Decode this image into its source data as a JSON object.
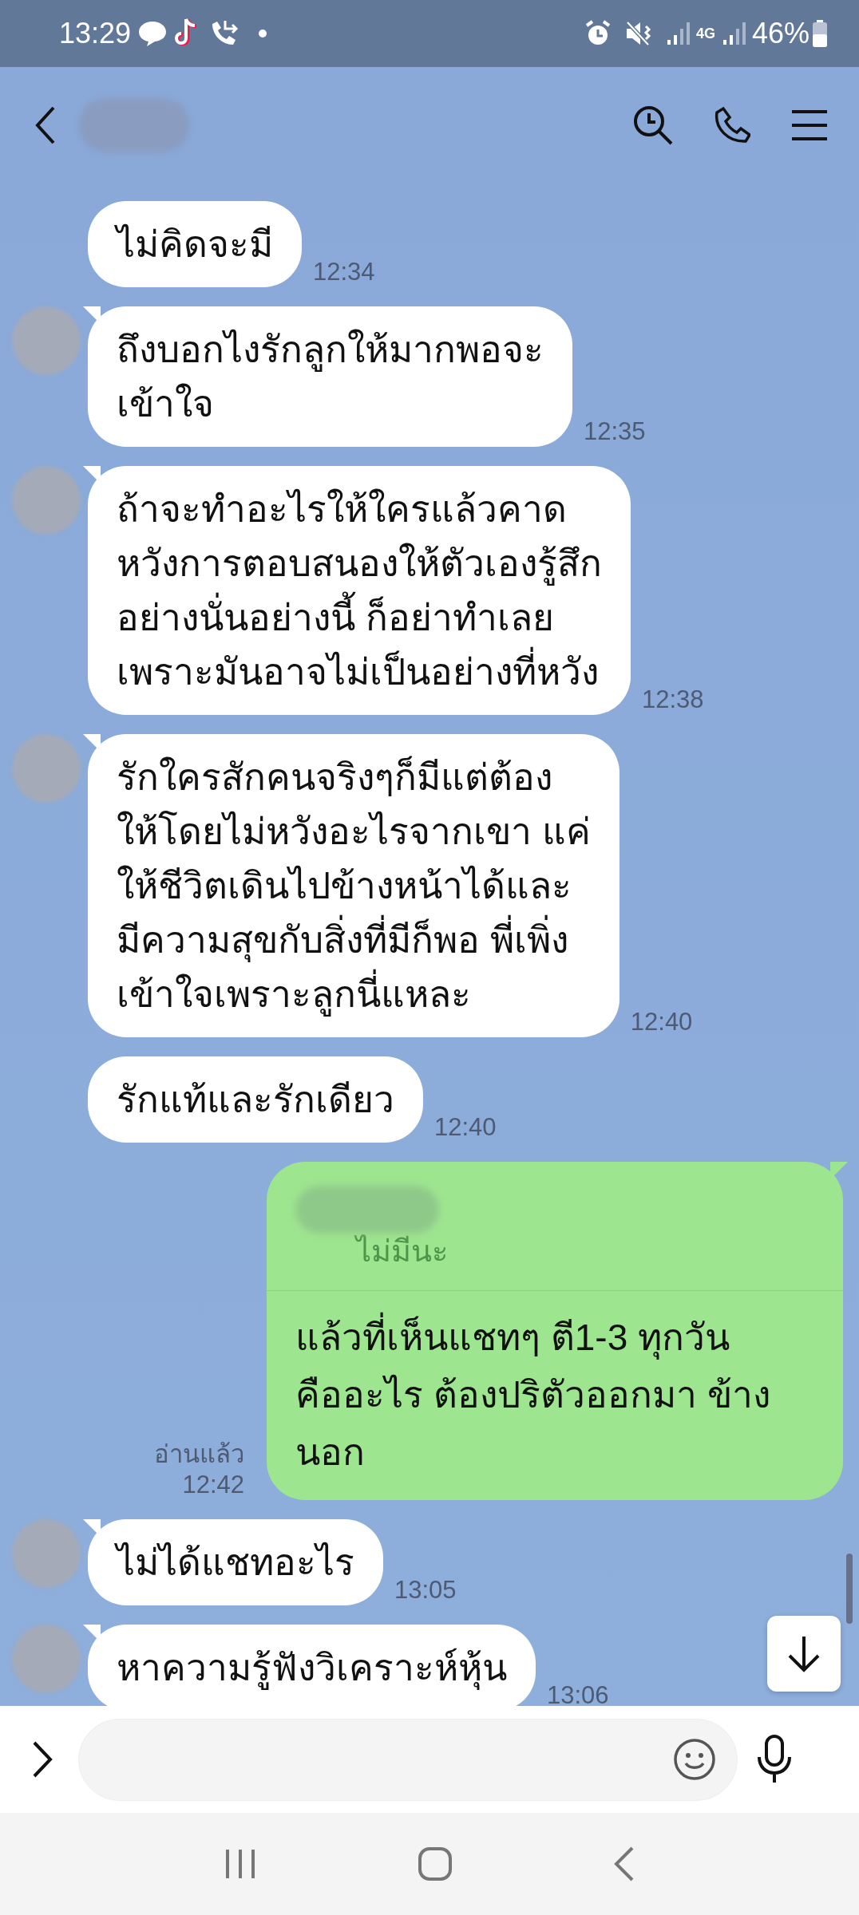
{
  "status_bar": {
    "time": "13:29",
    "network": "4G",
    "battery": "46%"
  },
  "messages": [
    {
      "kind": "received",
      "avatar": false,
      "lines": [
        "ไม่คิดจะมี"
      ],
      "time": "12:34"
    },
    {
      "kind": "received",
      "avatar": true,
      "lines": [
        "ถึงบอกไงรักลูกให้มากพอจะ",
        "เข้าใจ"
      ],
      "time": "12:35"
    },
    {
      "kind": "received",
      "avatar": true,
      "lines": [
        "ถ้าจะทำอะไรให้ใครแล้วคาด",
        "หวังการตอบสนองให้ตัวเองรู้สึก",
        "อย่างนั่นอย่างนี้ ก็อย่าทำเลย",
        "เพราะมันอาจไม่เป็นอย่างที่หวัง"
      ],
      "time": "12:38"
    },
    {
      "kind": "received",
      "avatar": true,
      "lines": [
        "รักใครสักคนจริงๆก็มีแต่ต้อง",
        "ให้โดยไม่หวังอะไรจากเขา แค่",
        "ให้ชีวิตเดินไปข้างหน้าได้และ",
        "มีความสุขกับสิ่งที่มีก็พอ พี่เพิ่ง",
        "เข้าใจเพราะลูกนี่แหละ"
      ],
      "time": "12:40"
    },
    {
      "kind": "received",
      "avatar": false,
      "lines": [
        "รักแท้และรักเดียว"
      ],
      "time": "12:40"
    },
    {
      "kind": "sent",
      "quote": "ไม่มีนะ",
      "lines": [
        "แล้วที่เห็นแชทๆ ตี1-3 ทุกวัน",
        "คืออะไร ต้องปริตัวออกมา ข้าง",
        "นอก"
      ],
      "read": "อ่านแล้ว",
      "time": "12:42"
    },
    {
      "kind": "received",
      "avatar": true,
      "lines": [
        "ไม่ได้แชทอะไร"
      ],
      "time": "13:05"
    },
    {
      "kind": "received",
      "avatar": true,
      "lines": [
        "หาความรู้ฟังวิเคราะห์หุ้น"
      ],
      "time": "13:06"
    }
  ]
}
